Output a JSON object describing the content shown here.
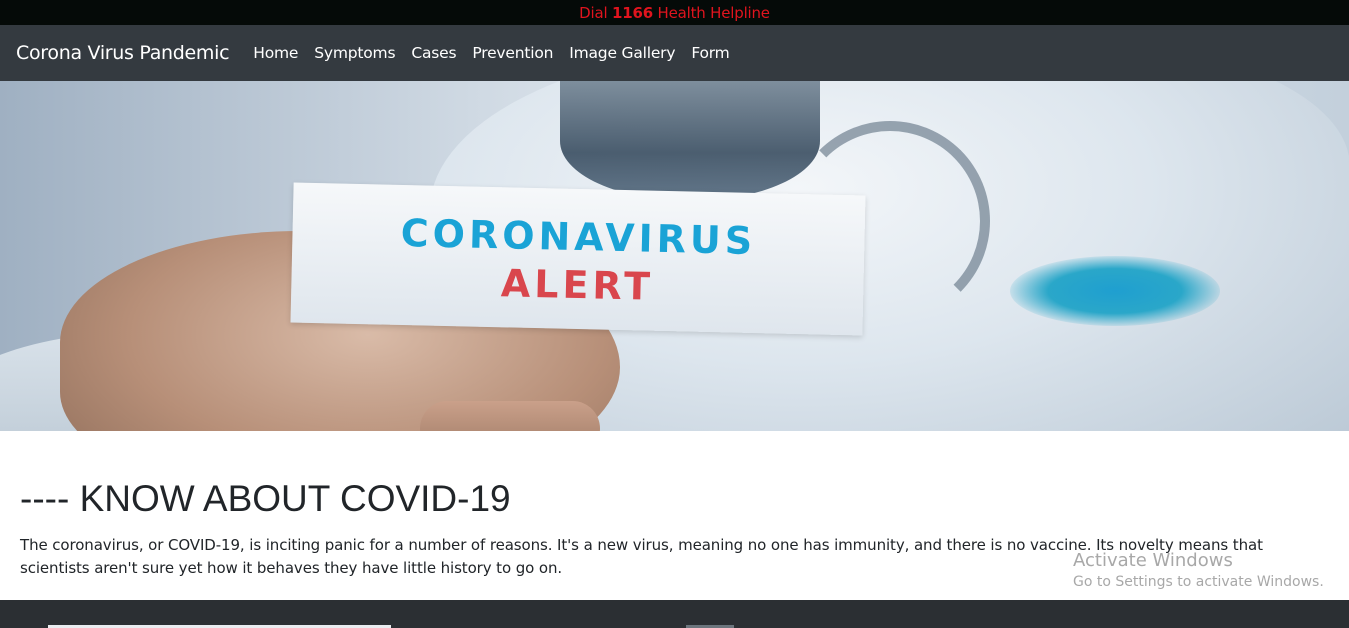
{
  "helpline": {
    "prefix": "Dial",
    "number": "1166",
    "suffix": "Health Helpline"
  },
  "navbar": {
    "brand": "Corona Virus Pandemic",
    "items": [
      {
        "label": "Home"
      },
      {
        "label": "Symptoms"
      },
      {
        "label": "Cases"
      },
      {
        "label": "Prevention"
      },
      {
        "label": "Image Gallery"
      },
      {
        "label": "Form"
      }
    ]
  },
  "hero": {
    "card_line1": "CORONAVIRUS",
    "card_line2": "ALERT"
  },
  "section": {
    "title": "---- KNOW ABOUT COVID-19",
    "text": "The coronavirus, or COVID-19, is inciting panic for a number of reasons. It's a new virus, meaning no one has immunity, and there is no vaccine. Its novelty means that scientists aren't sure yet how it behaves they have little history to go on."
  },
  "watermark": {
    "title": "Activate Windows",
    "subtitle": "Go to Settings to activate Windows."
  },
  "colors": {
    "helpline_text": "#e0141e",
    "navbar_bg": "#343a40",
    "card_blue": "#1aa3d6",
    "card_red": "#d9464d"
  }
}
